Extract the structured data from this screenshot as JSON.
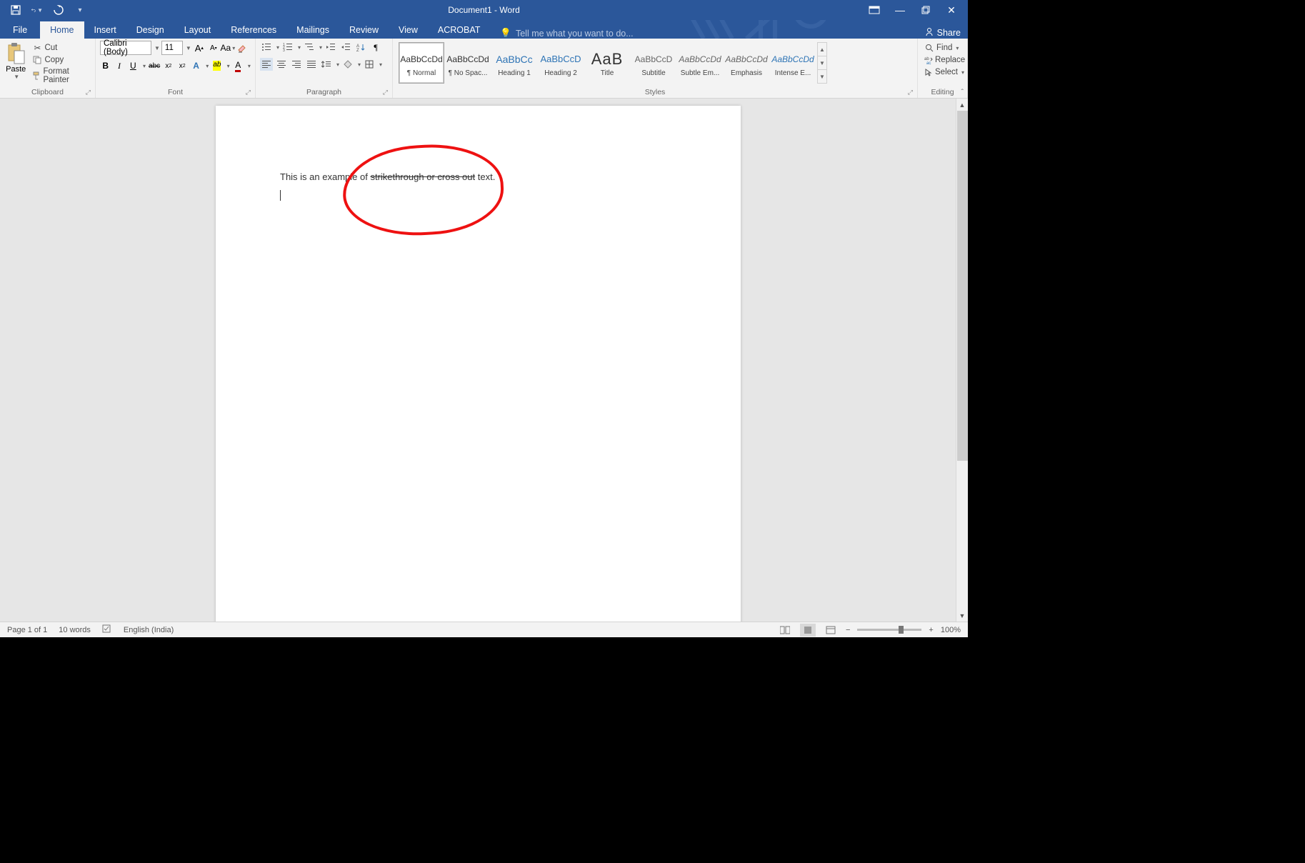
{
  "title": "Document1 - Word",
  "qat": {
    "save": "save-icon",
    "undo": "undo-icon",
    "redo": "redo-icon"
  },
  "tabs": {
    "file": "File",
    "items": [
      "Home",
      "Insert",
      "Design",
      "Layout",
      "References",
      "Mailings",
      "Review",
      "View",
      "ACROBAT"
    ],
    "active": "Home",
    "tell_placeholder": "Tell me what you want to do...",
    "share": "Share"
  },
  "clipboard": {
    "paste": "Paste",
    "cut": "Cut",
    "copy": "Copy",
    "painter": "Format Painter",
    "label": "Clipboard"
  },
  "font": {
    "name": "Calibri (Body)",
    "size": "11",
    "grow": "A",
    "shrink": "A",
    "case": "Aa",
    "clear": "clear-format-icon",
    "bold": "B",
    "italic": "I",
    "underline": "U",
    "strike": "abc",
    "sub": "x",
    "sup": "x",
    "texteffects": "A",
    "highlight": "ab",
    "color": "A",
    "label": "Font"
  },
  "paragraph": {
    "bullets": "bullets-icon",
    "numbers": "numbers-icon",
    "ml": "multilevel-icon",
    "dec": "decrease-indent-icon",
    "inc": "increase-indent-icon",
    "sort": "sort-icon",
    "marks": "¶",
    "al": "align-left-icon",
    "ac": "align-center-icon",
    "ar": "align-right-icon",
    "aj": "justify-icon",
    "ls": "line-spacing-icon",
    "shade": "shading-icon",
    "borders": "borders-icon",
    "label": "Paragraph"
  },
  "styles": {
    "items": [
      {
        "preview": "AaBbCcDd",
        "name": "¶ Normal",
        "cls": ""
      },
      {
        "preview": "AaBbCcDd",
        "name": "¶ No Spac...",
        "cls": ""
      },
      {
        "preview": "AaBbCc",
        "name": "Heading 1",
        "cls": "h1"
      },
      {
        "preview": "AaBbCcD",
        "name": "Heading 2",
        "cls": "h2"
      },
      {
        "preview": "AaB",
        "name": "Title",
        "cls": "title"
      },
      {
        "preview": "AaBbCcD",
        "name": "Subtitle",
        "cls": "subt"
      },
      {
        "preview": "AaBbCcDd",
        "name": "Subtle Em...",
        "cls": "emph"
      },
      {
        "preview": "AaBbCcDd",
        "name": "Emphasis",
        "cls": "emph"
      },
      {
        "preview": "AaBbCcDd",
        "name": "Intense E...",
        "cls": "iemph"
      }
    ],
    "label": "Styles"
  },
  "editing": {
    "find": "Find",
    "replace": "Replace",
    "select": "Select",
    "label": "Editing"
  },
  "document": {
    "text_before": "This is an example of ",
    "text_struck": "strikethrough or cross out",
    "text_after": " text."
  },
  "status": {
    "page": "Page 1 of 1",
    "words": "10 words",
    "lang": "English (India)",
    "zoom": "100%"
  }
}
